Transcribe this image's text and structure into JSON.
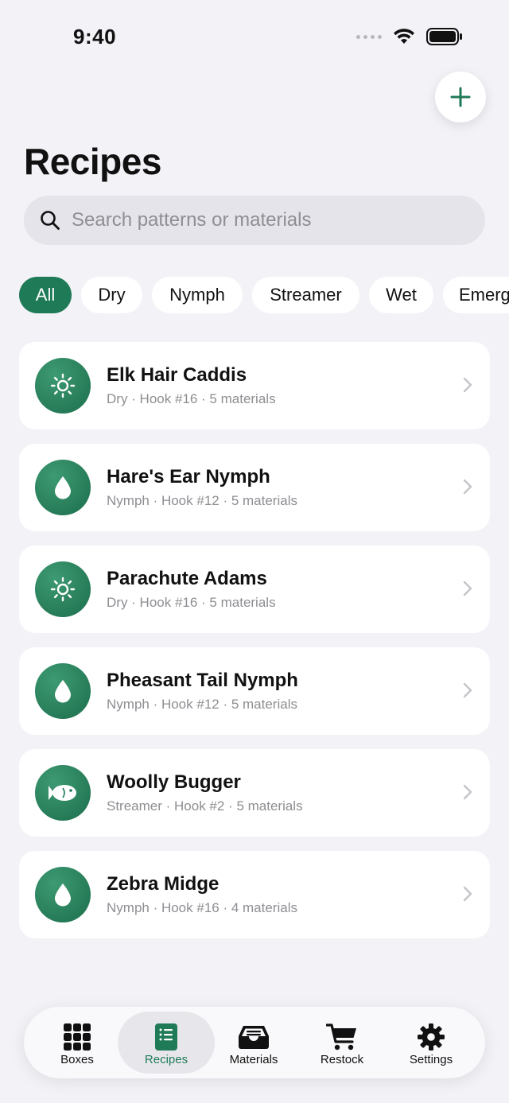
{
  "status_bar": {
    "time": "9:40"
  },
  "header": {
    "title": "Recipes",
    "add_button_icon": "plus-icon"
  },
  "search": {
    "placeholder": "Search patterns or materials",
    "value": ""
  },
  "filters": [
    {
      "label": "All",
      "active": true
    },
    {
      "label": "Dry",
      "active": false
    },
    {
      "label": "Nymph",
      "active": false
    },
    {
      "label": "Streamer",
      "active": false
    },
    {
      "label": "Wet",
      "active": false
    },
    {
      "label": "Emerg",
      "active": false
    }
  ],
  "recipes": [
    {
      "name": "Elk Hair Caddis",
      "meta": "Dry · Hook #16 · 5 materials",
      "icon": "sun-icon"
    },
    {
      "name": "Hare's Ear Nymph",
      "meta": "Nymph · Hook #12 · 5 materials",
      "icon": "drop-icon"
    },
    {
      "name": "Parachute Adams",
      "meta": "Dry · Hook #16 · 5 materials",
      "icon": "sun-icon"
    },
    {
      "name": "Pheasant Tail Nymph",
      "meta": "Nymph · Hook #12 · 5 materials",
      "icon": "drop-icon"
    },
    {
      "name": "Woolly Bugger",
      "meta": "Streamer · Hook #2 · 5 materials",
      "icon": "fish-icon"
    },
    {
      "name": "Zebra Midge",
      "meta": "Nymph · Hook #16 · 4 materials",
      "icon": "drop-icon"
    }
  ],
  "tab_bar": {
    "items": [
      {
        "label": "Boxes",
        "icon": "grid-icon",
        "active": false
      },
      {
        "label": "Recipes",
        "icon": "recipe-book-icon",
        "active": true
      },
      {
        "label": "Materials",
        "icon": "tray-icon",
        "active": false
      },
      {
        "label": "Restock",
        "icon": "cart-icon",
        "active": false
      },
      {
        "label": "Settings",
        "icon": "gear-icon",
        "active": false
      }
    ]
  },
  "colors": {
    "accent": "#1f7a57",
    "background": "#f2f2f7",
    "card": "#ffffff",
    "secondary_text": "#8e8e93"
  }
}
